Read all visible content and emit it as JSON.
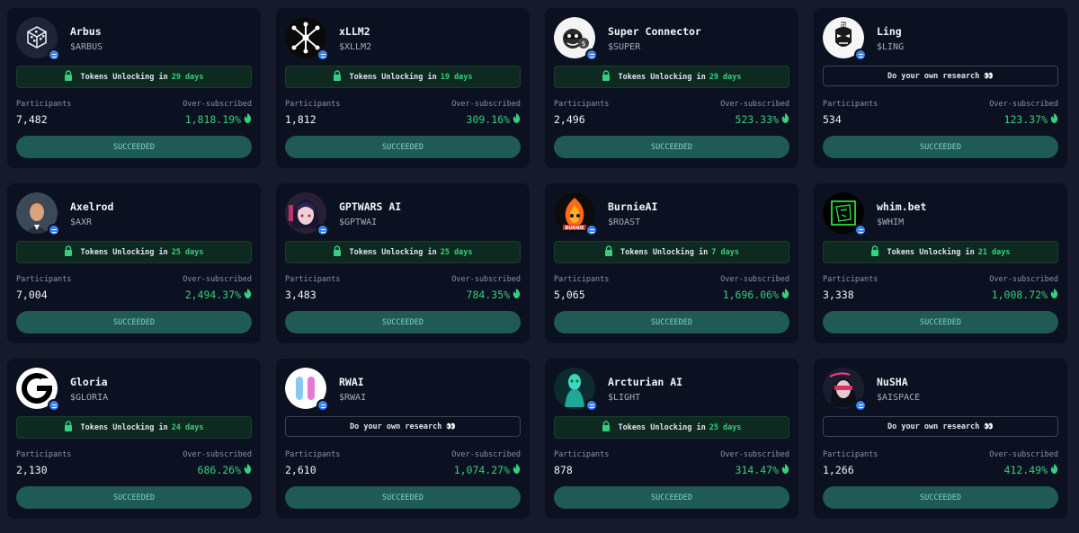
{
  "cards": [
    {
      "name": "Arbus",
      "ticker": "$ARBUS",
      "notice_type": "unlock",
      "unlock_prefix": "Tokens Unlocking in",
      "unlock_days": "29 days",
      "participants_label": "Participants",
      "participants": "7,482",
      "over_label": "Over-subscribed",
      "over": "1,818.19%",
      "status": "SUCCEEDED",
      "avatar_icon": "cube-icon"
    },
    {
      "name": "xLLM2",
      "ticker": "$XLLM2",
      "notice_type": "unlock",
      "unlock_prefix": "Tokens Unlocking in",
      "unlock_days": "19 days",
      "participants_label": "Participants",
      "participants": "1,812",
      "over_label": "Over-subscribed",
      "over": "309.16%",
      "status": "SUCCEEDED",
      "avatar_icon": "network-icon"
    },
    {
      "name": "Super Connector",
      "ticker": "$SUPER",
      "notice_type": "unlock",
      "unlock_prefix": "Tokens Unlocking in",
      "unlock_days": "29 days",
      "participants_label": "Participants",
      "participants": "2,496",
      "over_label": "Over-subscribed",
      "over": "523.33%",
      "status": "SUCCEEDED",
      "avatar_icon": "mascot-icon"
    },
    {
      "name": "Ling",
      "ticker": "$LING",
      "notice_type": "dyor",
      "dyor_text": "Do your own research 👀",
      "participants_label": "Participants",
      "participants": "534",
      "over_label": "Over-subscribed",
      "over": "123.37%",
      "status": "SUCCEEDED",
      "avatar_icon": "mask-icon"
    },
    {
      "name": "Axelrod",
      "ticker": "$AXR",
      "notice_type": "unlock",
      "unlock_prefix": "Tokens Unlocking in",
      "unlock_days": "25 days",
      "participants_label": "Participants",
      "participants": "7,004",
      "over_label": "Over-subscribed",
      "over": "2,494.37%",
      "status": "SUCCEEDED",
      "avatar_icon": "portrait-icon"
    },
    {
      "name": "GPTWARS AI",
      "ticker": "$GPTWAI",
      "notice_type": "unlock",
      "unlock_prefix": "Tokens Unlocking in",
      "unlock_days": "25 days",
      "participants_label": "Participants",
      "participants": "3,483",
      "over_label": "Over-subscribed",
      "over": "784.35%",
      "status": "SUCCEEDED",
      "avatar_icon": "anime-girl-icon"
    },
    {
      "name": "BurnieAI",
      "ticker": "$ROAST",
      "notice_type": "unlock",
      "unlock_prefix": "Tokens Unlocking in",
      "unlock_days": "7 days",
      "participants_label": "Participants",
      "participants": "5,065",
      "over_label": "Over-subscribed",
      "over": "1,696.06%",
      "status": "SUCCEEDED",
      "avatar_icon": "fire-mascot-icon"
    },
    {
      "name": "whim.bet",
      "ticker": "$WHIM",
      "notice_type": "unlock",
      "unlock_prefix": "Tokens Unlocking in",
      "unlock_days": "21 days",
      "participants_label": "Participants",
      "participants": "3,338",
      "over_label": "Over-subscribed",
      "over": "1,008.72%",
      "status": "SUCCEEDED",
      "avatar_icon": "neon-face-icon"
    },
    {
      "name": "Gloria",
      "ticker": "$GLORIA",
      "notice_type": "unlock",
      "unlock_prefix": "Tokens Unlocking in",
      "unlock_days": "24 days",
      "participants_label": "Participants",
      "participants": "2,130",
      "over_label": "Over-subscribed",
      "over": "686.26%",
      "status": "SUCCEEDED",
      "avatar_icon": "g-logo-icon"
    },
    {
      "name": "RWAI",
      "ticker": "$RWAI",
      "notice_type": "dyor",
      "dyor_text": "Do your own research 👀",
      "participants_label": "Participants",
      "participants": "2,610",
      "over_label": "Over-subscribed",
      "over": "1,074.27%",
      "status": "SUCCEEDED",
      "avatar_icon": "pause-logo-icon"
    },
    {
      "name": "Arcturian AI",
      "ticker": "$LIGHT",
      "notice_type": "unlock",
      "unlock_prefix": "Tokens Unlocking in",
      "unlock_days": "25 days",
      "participants_label": "Participants",
      "participants": "878",
      "over_label": "Over-subscribed",
      "over": "314.47%",
      "status": "SUCCEEDED",
      "avatar_icon": "alien-icon"
    },
    {
      "name": "NuSHA",
      "ticker": "$AISPACE",
      "notice_type": "dyor",
      "dyor_text": "Do your own research 👀",
      "participants_label": "Participants",
      "participants": "1,266",
      "over_label": "Over-subscribed",
      "over": "412.49%",
      "status": "SUCCEEDED",
      "avatar_icon": "cyber-girl-icon"
    }
  ],
  "colors": {
    "background": "#161a2a",
    "card": "#0b1120",
    "accent_green": "#35d07f",
    "status_button": "#1f5a55",
    "verified_badge": "#3b82f6"
  }
}
